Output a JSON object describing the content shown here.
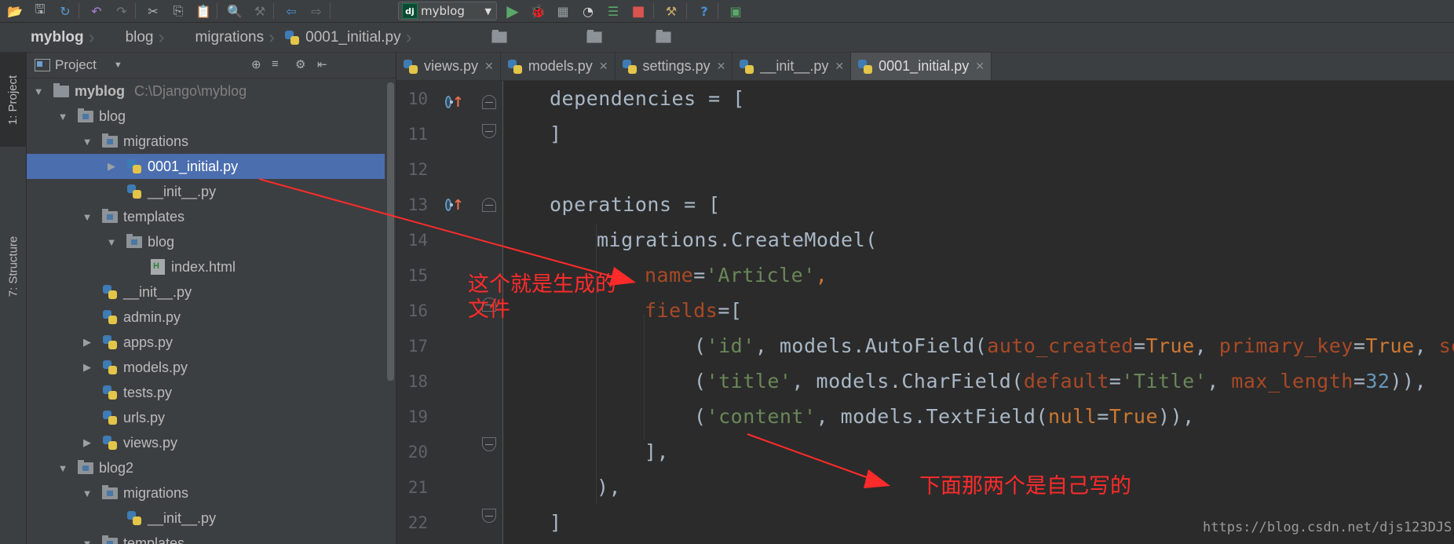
{
  "toolbar": {
    "run_config": "myblog",
    "run_badge": "dj"
  },
  "breadcrumb": [
    {
      "label": "myblog",
      "bold": true
    },
    {
      "label": "blog"
    },
    {
      "label": "migrations"
    },
    {
      "label": "0001_initial.py",
      "py": true
    }
  ],
  "tool_strip": {
    "project": "1: Project",
    "structure": "7: Structure"
  },
  "project_panel": {
    "title": "Project",
    "tree": [
      {
        "label": "myblog",
        "hint": "C:\\Django\\myblog",
        "type": "folder",
        "depth": 0,
        "arrow": "down",
        "bold": true
      },
      {
        "label": "blog",
        "type": "folder",
        "depth": 1,
        "arrow": "down"
      },
      {
        "label": "migrations",
        "type": "folder",
        "depth": 2,
        "arrow": "down"
      },
      {
        "label": "0001_initial.py",
        "type": "py",
        "depth": 3,
        "arrow": "right",
        "selected": true
      },
      {
        "label": "__init__.py",
        "type": "py",
        "depth": 3,
        "arrow": "none"
      },
      {
        "label": "templates",
        "type": "folder",
        "depth": 2,
        "arrow": "down"
      },
      {
        "label": "blog",
        "type": "folder",
        "depth": 3,
        "arrow": "down"
      },
      {
        "label": "index.html",
        "type": "html",
        "depth": 4,
        "arrow": "none"
      },
      {
        "label": "__init__.py",
        "type": "py",
        "depth": 2,
        "arrow": "none"
      },
      {
        "label": "admin.py",
        "type": "py",
        "depth": 2,
        "arrow": "none"
      },
      {
        "label": "apps.py",
        "type": "py",
        "depth": 2,
        "arrow": "right"
      },
      {
        "label": "models.py",
        "type": "py",
        "depth": 2,
        "arrow": "right"
      },
      {
        "label": "tests.py",
        "type": "py",
        "depth": 2,
        "arrow": "none"
      },
      {
        "label": "urls.py",
        "type": "py",
        "depth": 2,
        "arrow": "none"
      },
      {
        "label": "views.py",
        "type": "py",
        "depth": 2,
        "arrow": "right"
      },
      {
        "label": "blog2",
        "type": "folder",
        "depth": 1,
        "arrow": "down"
      },
      {
        "label": "migrations",
        "type": "folder",
        "depth": 2,
        "arrow": "down"
      },
      {
        "label": "__init__.py",
        "type": "py",
        "depth": 3,
        "arrow": "none"
      },
      {
        "label": "templates",
        "type": "folder",
        "depth": 2,
        "arrow": "down"
      }
    ]
  },
  "editor_tabs": [
    {
      "label": "views.py"
    },
    {
      "label": "models.py"
    },
    {
      "label": "settings.py"
    },
    {
      "label": "__init__.py"
    },
    {
      "label": "0001_initial.py",
      "active": true
    }
  ],
  "line_numbers": [
    "10",
    "11",
    "12",
    "13",
    "14",
    "15",
    "16",
    "17",
    "18",
    "19",
    "20",
    "21",
    "22"
  ],
  "code": {
    "l10_name": "dependencies",
    "l10_rest": " = [",
    "l11": "]",
    "l13_name": "operations",
    "l13_rest": " = [",
    "l14": "migrations.CreateModel(",
    "l15_param": "name",
    "l15_eq": "=",
    "l15_str": "'Article'",
    "l15_end": ",",
    "l16_param": "fields",
    "l16_rest": "=[",
    "l17_a": "(",
    "l17_str": "'id'",
    "l17_b": ", models.AutoField(",
    "l17_p1": "auto_created",
    "l17_eq1": "=",
    "l17_kw1": "True",
    "l17_c": ", ",
    "l17_p2": "primary_key",
    "l17_eq2": "=",
    "l17_kw2": "True",
    "l17_d": ", ",
    "l17_p3": "seri",
    "l18_a": "(",
    "l18_str": "'title'",
    "l18_b": ", models.CharField(",
    "l18_p1": "default",
    "l18_eq1": "=",
    "l18_str2": "'Title'",
    "l18_c": ", ",
    "l18_p2": "max_length",
    "l18_eq2": "=",
    "l18_num": "32",
    "l18_end": ")),",
    "l19_a": "(",
    "l19_str": "'content'",
    "l19_b": ", models.TextField(",
    "l19_p1": "null",
    "l19_eq1": "=",
    "l19_kw1": "True",
    "l19_end": ")),",
    "l20": "],",
    "l21": "),",
    "l22": "]"
  },
  "annotations": {
    "note1_line1": "这个就是生成的",
    "note1_line2": "文件",
    "note2": "下面那两个是自己写的",
    "color": "#ff2b2b"
  },
  "watermark": "https://blog.csdn.net/djs123DJS"
}
